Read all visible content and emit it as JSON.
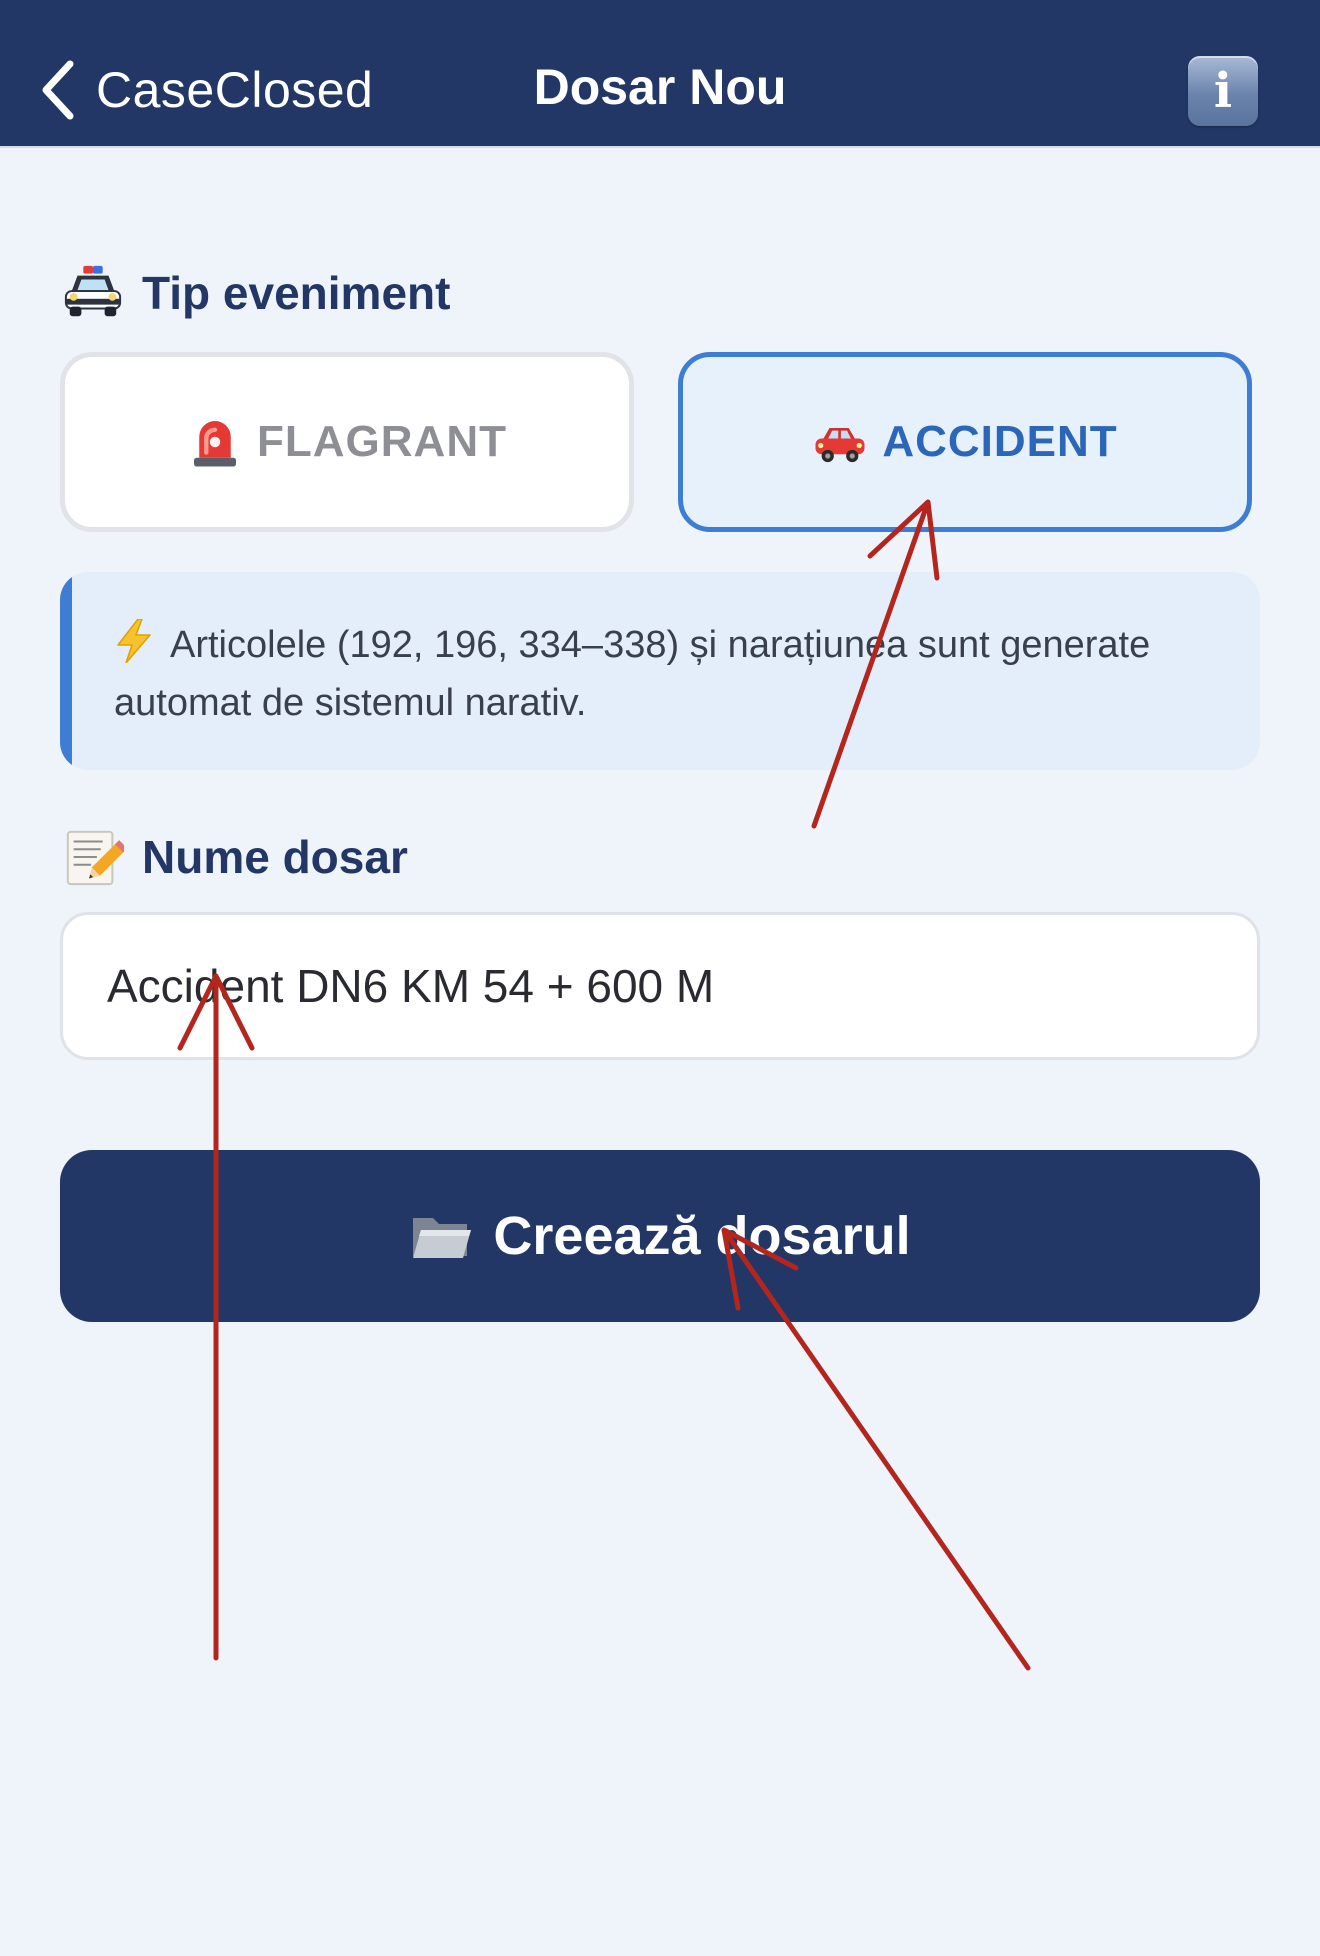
{
  "navbar": {
    "back_label": "CaseClosed",
    "title": "Dosar Nou",
    "info_label": "i",
    "background": "#223766"
  },
  "event_type": {
    "label": "Tip eveniment",
    "label_icon": "police-car-icon",
    "options": [
      {
        "label": "FLAGRANT",
        "icon": "siren-light-icon",
        "selected": false
      },
      {
        "label": "ACCIDENT",
        "icon": "car-icon",
        "selected": true
      }
    ],
    "selected_color": "#3d7ed4"
  },
  "info": {
    "icon": "lightning-icon",
    "text": "Articolele (192, 196, 334–338) și narațiunea sunt generate automat de sistemul narativ."
  },
  "case_name": {
    "label": "Nume dosar",
    "label_icon": "memo-pencil-icon",
    "value": "Accident DN6 KM 54 + 600 M"
  },
  "create_button": {
    "label": "Creează dosarul",
    "icon": "folder-icon"
  },
  "annotation_color": "#b3261e"
}
